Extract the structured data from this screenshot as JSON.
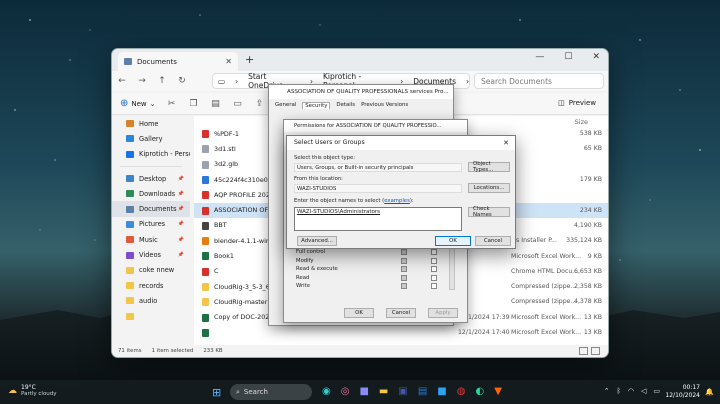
{
  "explorer": {
    "tab_title": "Documents",
    "address": [
      "Start OneDrive",
      "Kiprotich - Personal",
      "Documents"
    ],
    "search_placeholder": "Search Documents",
    "new_label": "New",
    "preview_label": "Preview",
    "size_header": "Size",
    "sidebar": [
      {
        "label": "Home",
        "icon": "home-icon",
        "color": "#d9822b"
      },
      {
        "label": "Gallery",
        "icon": "gallery-icon",
        "color": "#2b88d8"
      },
      {
        "label": "Kiprotich - Perso",
        "icon": "onedrive-icon",
        "color": "#1a73e8"
      },
      {
        "label": "Desktop",
        "icon": "desktop-icon",
        "color": "#3a86c8",
        "pinned": true
      },
      {
        "label": "Downloads",
        "icon": "download-icon",
        "color": "#2e8b57",
        "pinned": true
      },
      {
        "label": "Documents",
        "icon": "documents-icon",
        "color": "#5d7ea8",
        "pinned": true,
        "selected": true
      },
      {
        "label": "Pictures",
        "icon": "pictures-icon",
        "color": "#3c8dde",
        "pinned": true
      },
      {
        "label": "Music",
        "icon": "music-icon",
        "color": "#e25a3c",
        "pinned": true
      },
      {
        "label": "Videos",
        "icon": "videos-icon",
        "color": "#7c4dce",
        "pinned": true
      },
      {
        "label": "coke nnew",
        "icon": "folder-icon",
        "color": "#f3c64a"
      },
      {
        "label": "records",
        "icon": "folder-icon",
        "color": "#f3c64a"
      },
      {
        "label": "audio",
        "icon": "folder-icon",
        "color": "#f3c64a"
      },
      {
        "label": "",
        "icon": "folder-icon",
        "color": "#f3c64a"
      }
    ],
    "files": [
      {
        "name": "%PDF-1",
        "date": "",
        "type": "",
        "size": "538 KB",
        "color": "#d9302b"
      },
      {
        "name": "3d1.stl",
        "date": "",
        "type": "",
        "size": "65 KB",
        "color": "#9aa3ad"
      },
      {
        "name": "3d2.glb",
        "date": "",
        "type": "",
        "size": "",
        "color": "#9aa3ad"
      },
      {
        "name": "45c224f4c310e0dc9",
        "date": "",
        "type": "",
        "size": "179 KB",
        "color": "#2b78d8"
      },
      {
        "name": "AQP PROFILE 2024",
        "date": "",
        "type": "",
        "size": "",
        "color": "#d9302b"
      },
      {
        "name": "ASSOCIATION OF QU",
        "date": "",
        "type": "",
        "size": "234 KB",
        "color": "#d9302b",
        "selected": true
      },
      {
        "name": "BBT",
        "date": "",
        "type": "",
        "size": "4,190 KB",
        "color": "#444444"
      },
      {
        "name": "blender-4.1.1-windo",
        "date": "",
        "type": "ws Installer P...",
        "size": "335,124 KB",
        "color": "#e87d0d"
      },
      {
        "name": "Book1",
        "date": "",
        "type": "Microsoft Excel Work...",
        "size": "9 KB",
        "color": "#1e7145"
      },
      {
        "name": "C",
        "date": "",
        "type": "Chrome HTML Docu...",
        "size": "6,653 KB",
        "color": "#d9302b"
      },
      {
        "name": "CloudRig-3_5-3_6_3",
        "date": "",
        "type": "Compressed (zippe...",
        "size": "2,358 KB",
        "color": "#f3c64a"
      },
      {
        "name": "CloudRig-master",
        "date": "",
        "type": "Compressed (zippe...",
        "size": "4,378 KB",
        "color": "#f3c64a"
      },
      {
        "name": "Copy of DOC-20241130-WA0034(1)",
        "date": "12/1/2024 17:39",
        "type": "Microsoft Excel Work...",
        "size": "13 KB",
        "color": "#1e7145"
      },
      {
        "name": "",
        "date": "12/1/2024 17:40",
        "type": "Microsoft Excel Work...",
        "size": "13 KB",
        "color": "#1e7145"
      }
    ],
    "status": [
      "71 items",
      "1 item selected",
      "233 KB"
    ]
  },
  "props_dialog": {
    "title": "ASSOCIATION OF QUALITY PROFESSIONALS services Pro...",
    "tabs": [
      "General",
      "Security",
      "Details",
      "Previous Versions"
    ]
  },
  "perms_dialog": {
    "title": "Permissions for ASSOCIATION OF QUALITY PROFESSIO...",
    "rows": [
      {
        "label": "Full control",
        "allow": true,
        "deny": false
      },
      {
        "label": "Modify",
        "allow": true,
        "deny": false
      },
      {
        "label": "Read & execute",
        "allow": true,
        "deny": false
      },
      {
        "label": "Read",
        "allow": true,
        "deny": false
      },
      {
        "label": "Write",
        "allow": true,
        "deny": false
      }
    ],
    "ok": "OK",
    "cancel": "Cancel",
    "apply": "Apply"
  },
  "select_dialog": {
    "title": "Select Users or Groups",
    "object_type_label": "Select this object type:",
    "object_type_value": "Users, Groups, or Built-in security principals",
    "object_types_btn": "Object Types...",
    "location_label": "From this location:",
    "location_value": "WAZI-STUDIOS",
    "locations_btn": "Locations...",
    "names_label": "Enter the object names to select",
    "examples_link": "examples",
    "names_value": "WAZI-STUDIOS\\Administrators",
    "check_names_btn": "Check Names",
    "advanced_btn": "Advanced...",
    "ok_btn": "OK",
    "cancel_btn": "Cancel"
  },
  "taskbar": {
    "temp": "19°C",
    "weather": "Partly cloudy",
    "search": "Search",
    "time": "00:17",
    "date": "12/10/2024"
  }
}
